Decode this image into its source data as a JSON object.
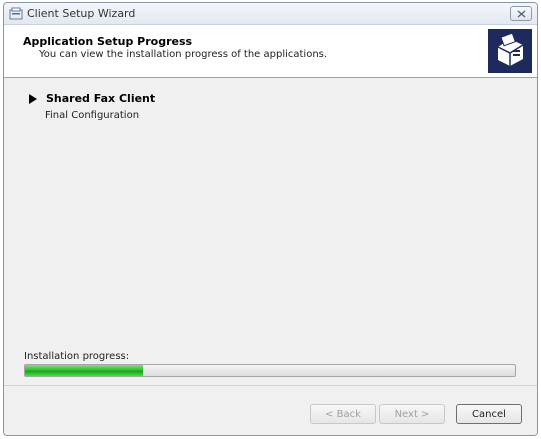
{
  "window": {
    "title": "Client Setup Wizard",
    "close_icon": "close-icon"
  },
  "header": {
    "title": "Application Setup Progress",
    "subtitle": "You can view the installation progress of the applications.",
    "logo_icon": "fax-machine-icon"
  },
  "body": {
    "application": {
      "name": "Shared Fax Client",
      "status": "Final Configuration"
    },
    "progress": {
      "label": "Installation progress:",
      "value": 0.24,
      "color": "#2fc22f"
    }
  },
  "footer": {
    "back_label": "< Back",
    "next_label": "Next >",
    "cancel_label": "Cancel"
  }
}
